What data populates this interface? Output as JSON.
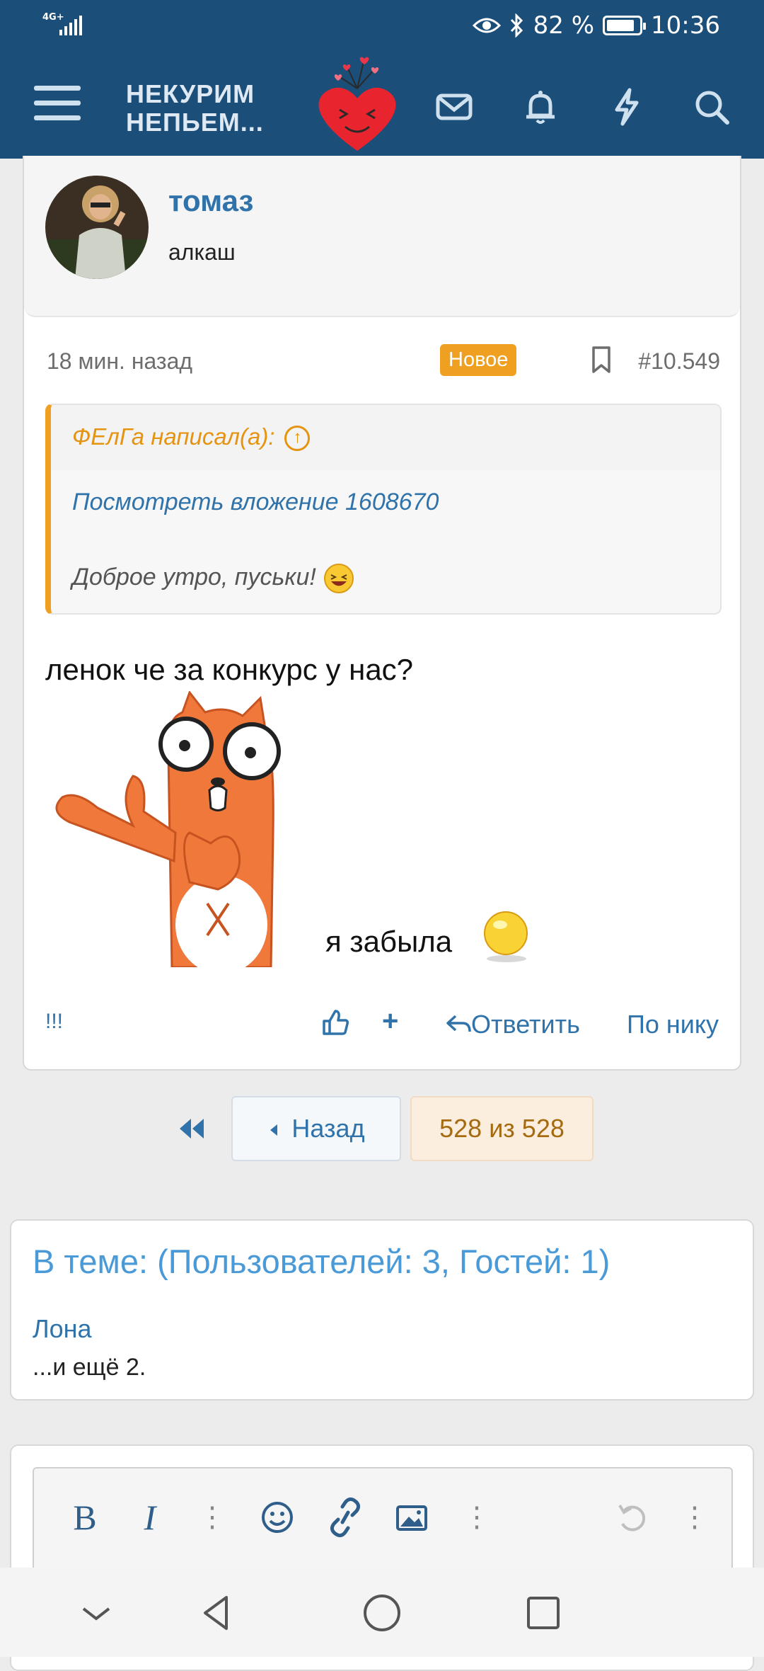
{
  "status_bar": {
    "network": "4G+",
    "battery_percent": "82 %",
    "time": "10:36"
  },
  "header": {
    "brand_line1": "НЕКУРИМ",
    "brand_line2": "НЕПЬЕМ...",
    "icons": [
      "menu-icon",
      "mail-icon",
      "bell-icon",
      "lightning-icon",
      "search-icon"
    ]
  },
  "post": {
    "username": "томаз",
    "user_title": "алкаш",
    "time_ago": "18 мин. назад",
    "badge": "Новое",
    "post_number": "#10.549",
    "quote": {
      "author": "ФЕлГа написал(а):",
      "attachment_link": "Посмотреть вложение 1608670",
      "text": "Доброе утро, пуськи!"
    },
    "message": "ленок че за конкурс у нас?",
    "message2": "я забыла",
    "actions": {
      "exclaim": "!!!",
      "reply": "Ответить",
      "by_nick": "По нику"
    }
  },
  "pager": {
    "back": "Назад",
    "pages": "528 из 528"
  },
  "online": {
    "title": "В теме: (Пользователей: 3, Гостей: 1)",
    "user": "Лона",
    "more": "...и ещё 2."
  },
  "colors": {
    "header_bg": "#1b4e79",
    "link": "#2f73aa",
    "accent_orange": "#f0a020",
    "page_bg": "#ececec"
  }
}
